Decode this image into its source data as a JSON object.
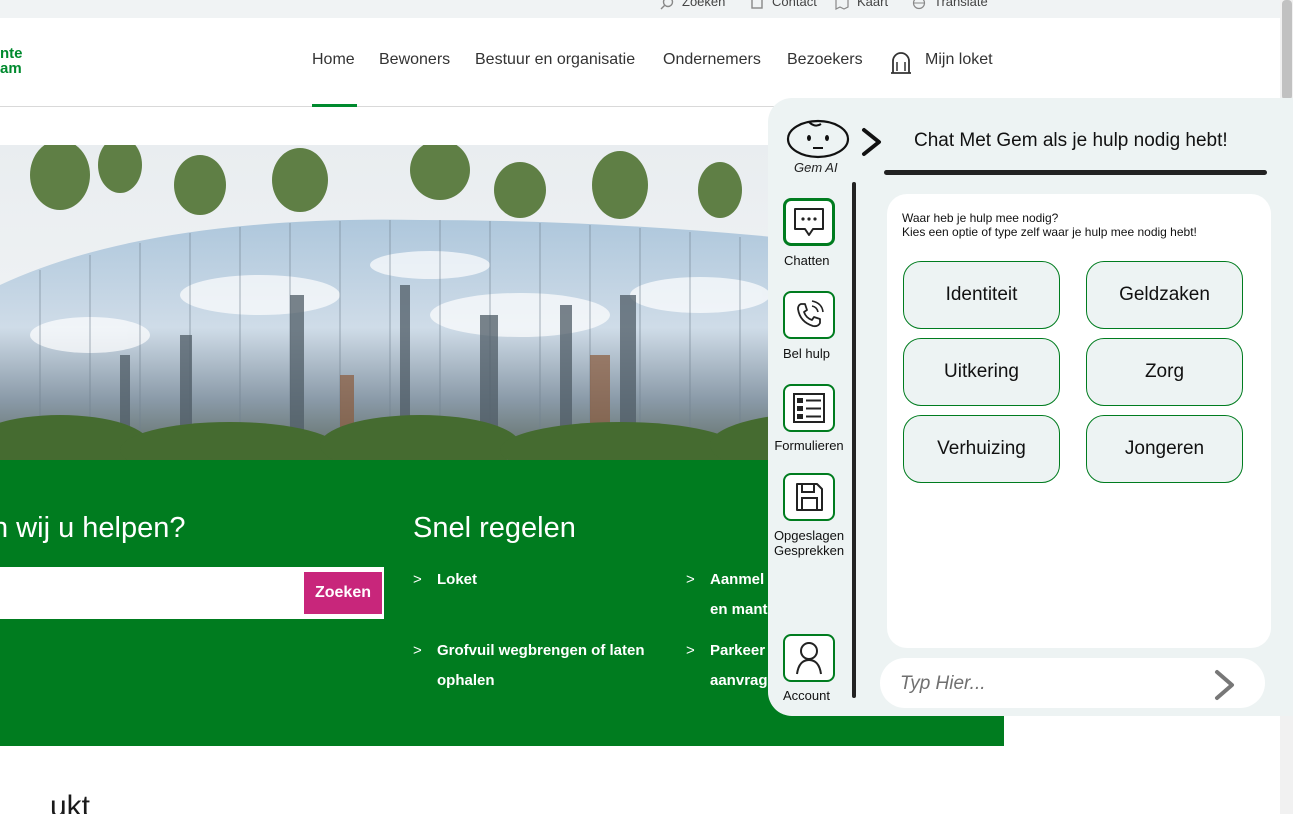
{
  "utility": {
    "search": "Zoeken",
    "contact": "Contact",
    "map": "Kaart",
    "translate": "Translate"
  },
  "logo": {
    "line1": "nte",
    "line2": "am"
  },
  "nav": {
    "items": [
      "Home",
      "Bewoners",
      "Bestuur en organisatie",
      "Ondernemers",
      "Bezoekers"
    ],
    "loket": "Mijn loket"
  },
  "help": {
    "title": "n wij u helpen?",
    "search_placeholder": "",
    "search_button": "Zoeken"
  },
  "snel": {
    "title": "Snel regelen",
    "links": [
      {
        "line1": "Loket",
        "line2": ""
      },
      {
        "line1": "Grofvuil wegbrengen of laten",
        "line2": "ophalen"
      },
      {
        "line1": "Aanmel",
        "line2": "en mant"
      },
      {
        "line1": "Parkeer",
        "line2": "aanvrag"
      }
    ]
  },
  "bottom_text": "ukt",
  "chat": {
    "assistant_name": "Gem AI",
    "header_title": "Chat Met Gem als je hulp nodig hebt!",
    "sidebar": [
      {
        "label": "Chatten",
        "icon": "chat-bubble-icon"
      },
      {
        "label": "Bel hulp",
        "icon": "phone-icon"
      },
      {
        "label": "Formulieren",
        "icon": "list-icon"
      },
      {
        "label": "Opgeslagen\nGesprekken",
        "icon": "save-icon"
      },
      {
        "label": "Account",
        "icon": "user-icon"
      }
    ],
    "prompt_line1": "Waar heb je hulp mee nodig?",
    "prompt_line2": "Kies een optie of type zelf waar je hulp mee nodig hebt!",
    "options": [
      "Identiteit",
      "Geldzaken",
      "Uitkering",
      "Zorg",
      "Verhuizing",
      "Jongeren"
    ],
    "input_placeholder": "Typ Hier..."
  },
  "colors": {
    "brand_green": "#007c1f",
    "accent_pink": "#c8267b",
    "chat_bg": "#edf3f3"
  }
}
